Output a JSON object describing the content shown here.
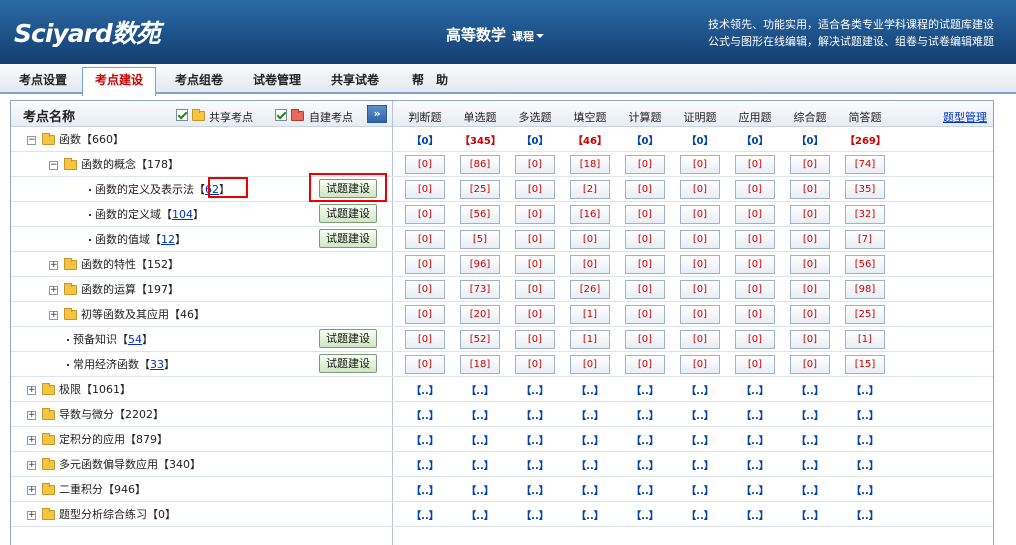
{
  "header": {
    "logo": "Sciyard数苑",
    "course": "高等数学",
    "course_sub": "课程",
    "slogan_line1": "技术领先、功能实用，适合各类专业学科课程的试题库建设",
    "slogan_line2": "公式与图形在线编辑，解决试题建设、组卷与试卷编辑难题"
  },
  "tabs": [
    "考点设置",
    "考点建设",
    "考点组卷",
    "试卷管理",
    "共享试卷",
    "帮　助"
  ],
  "active_tab": "考点建设",
  "panel": {
    "title": "考点名称",
    "filter_shared": "共享考点",
    "filter_own": "自建考点",
    "expand_icon": "»",
    "columns": [
      "判断题",
      "单选题",
      "多选题",
      "填空题",
      "计算题",
      "证明题",
      "应用题",
      "综合题",
      "简答题"
    ],
    "manage_link": "题型管理",
    "build_label": "试题建设"
  },
  "rows": [
    {
      "label": "函数【660】",
      "counts": [
        "【0】",
        "【345】",
        "【0】",
        "【46】",
        "【0】",
        "【0】",
        "【0】",
        "【0】",
        "【269】"
      ]
    },
    {
      "label": "函数的概念【178】",
      "counts": [
        "[0]",
        "[86]",
        "[0]",
        "[18]",
        "[0]",
        "[0]",
        "[0]",
        "[0]",
        "[74]"
      ]
    },
    {
      "label_pre": "函数的定义及表示法【",
      "label_num": "62",
      "label_post": "】",
      "counts": [
        "[0]",
        "[25]",
        "[0]",
        "[2]",
        "[0]",
        "[0]",
        "[0]",
        "[0]",
        "[35]"
      ]
    },
    {
      "label_pre": "函数的定义域【",
      "label_num": "104",
      "label_post": "】",
      "counts": [
        "[0]",
        "[56]",
        "[0]",
        "[16]",
        "[0]",
        "[0]",
        "[0]",
        "[0]",
        "[32]"
      ]
    },
    {
      "label_pre": "函数的值域【",
      "label_num": "12",
      "label_post": "】",
      "counts": [
        "[0]",
        "[5]",
        "[0]",
        "[0]",
        "[0]",
        "[0]",
        "[0]",
        "[0]",
        "[7]"
      ]
    },
    {
      "label": "函数的特性【152】",
      "counts": [
        "[0]",
        "[96]",
        "[0]",
        "[0]",
        "[0]",
        "[0]",
        "[0]",
        "[0]",
        "[56]"
      ]
    },
    {
      "label": "函数的运算【197】",
      "counts": [
        "[0]",
        "[73]",
        "[0]",
        "[26]",
        "[0]",
        "[0]",
        "[0]",
        "[0]",
        "[98]"
      ]
    },
    {
      "label": "初等函数及其应用【46】",
      "counts": [
        "[0]",
        "[20]",
        "[0]",
        "[1]",
        "[0]",
        "[0]",
        "[0]",
        "[0]",
        "[25]"
      ]
    },
    {
      "label_pre": "预备知识【",
      "label_num": "54",
      "label_post": "】",
      "counts": [
        "[0]",
        "[52]",
        "[0]",
        "[1]",
        "[0]",
        "[0]",
        "[0]",
        "[0]",
        "[1]"
      ]
    },
    {
      "label_pre": "常用经济函数【",
      "label_num": "33",
      "label_post": "】",
      "counts": [
        "[0]",
        "[18]",
        "[0]",
        "[0]",
        "[0]",
        "[0]",
        "[0]",
        "[0]",
        "[15]"
      ]
    },
    {
      "label": "极限【1061】",
      "counts": [
        "【..】",
        "【..】",
        "【..】",
        "【..】",
        "【..】",
        "【..】",
        "【..】",
        "【..】",
        "【..】"
      ]
    },
    {
      "label": "导数与微分【2202】",
      "counts": [
        "【..】",
        "【..】",
        "【..】",
        "【..】",
        "【..】",
        "【..】",
        "【..】",
        "【..】",
        "【..】"
      ]
    },
    {
      "label": "定积分的应用【879】",
      "counts": [
        "【..】",
        "【..】",
        "【..】",
        "【..】",
        "【..】",
        "【..】",
        "【..】",
        "【..】",
        "【..】"
      ]
    },
    {
      "label": "多元函数偏导数应用【340】",
      "counts": [
        "【..】",
        "【..】",
        "【..】",
        "【..】",
        "【..】",
        "【..】",
        "【..】",
        "【..】",
        "【..】"
      ]
    },
    {
      "label": "二重积分【946】",
      "counts": [
        "【..】",
        "【..】",
        "【..】",
        "【..】",
        "【..】",
        "【..】",
        "【..】",
        "【..】",
        "【..】"
      ]
    },
    {
      "label": "题型分析综合练习【0】",
      "counts": [
        "【..】",
        "【..】",
        "【..】",
        "【..】",
        "【..】",
        "【..】",
        "【..】",
        "【..】",
        "【..】"
      ]
    }
  ]
}
